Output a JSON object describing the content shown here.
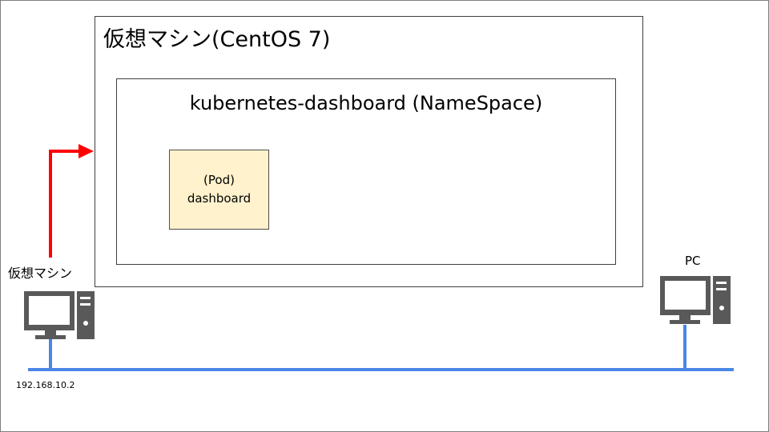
{
  "vm_outer": {
    "title": "仮想マシン(CentOS 7)"
  },
  "namespace": {
    "title": "kubernetes-dashboard (NameSpace)"
  },
  "pod": {
    "line1": "(Pod)",
    "line2": "dashboard"
  },
  "left_host": {
    "label": "仮想マシン",
    "ip": "192.168.10.2",
    "icon": "desktop-computer-icon"
  },
  "right_host": {
    "label": "PC",
    "icon": "desktop-computer-icon"
  },
  "colors": {
    "network_line": "#4a86e8",
    "arrow": "#ff0000",
    "pod_fill": "#fff2cc",
    "computer_icon": "#595959"
  }
}
